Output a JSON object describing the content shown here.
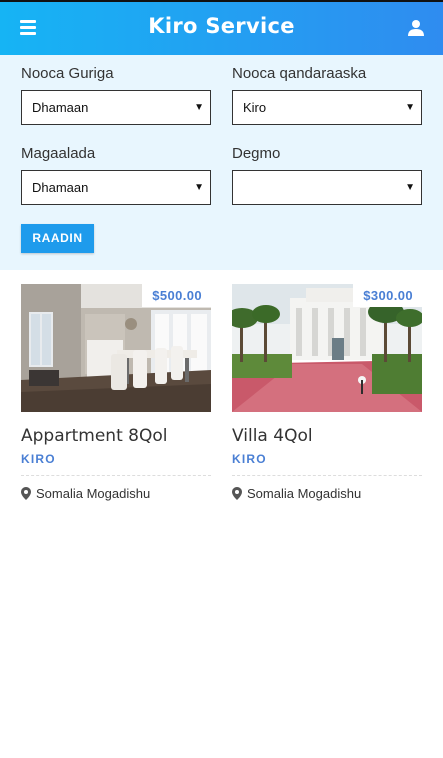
{
  "header": {
    "title": "Kiro Service",
    "menu_icon": "hamburger-menu-icon",
    "user_icon": "user-icon",
    "gradient_start": "#16b4f4",
    "gradient_end": "#2f8cf0"
  },
  "filters": {
    "house_type": {
      "label": "Nooca Guriga",
      "value": "Dhamaan"
    },
    "contract_type": {
      "label": "Nooca qandaraaska",
      "value": "Kiro"
    },
    "city": {
      "label": "Magaalada",
      "value": "Dhamaan"
    },
    "district": {
      "label": "Degmo",
      "value": ""
    },
    "search_button": "RAADIN",
    "background": "#e8f6fe"
  },
  "listings": [
    {
      "price": "$500.00",
      "title": "Appartment 8Qol",
      "type": "KIRO",
      "location": "Somalia Mogadishu"
    },
    {
      "price": "$300.00",
      "title": "Villa 4Qol",
      "type": "KIRO",
      "location": "Somalia Mogadishu"
    }
  ],
  "colors": {
    "accent": "#1e9bec",
    "price_text": "#4a7fd4"
  }
}
